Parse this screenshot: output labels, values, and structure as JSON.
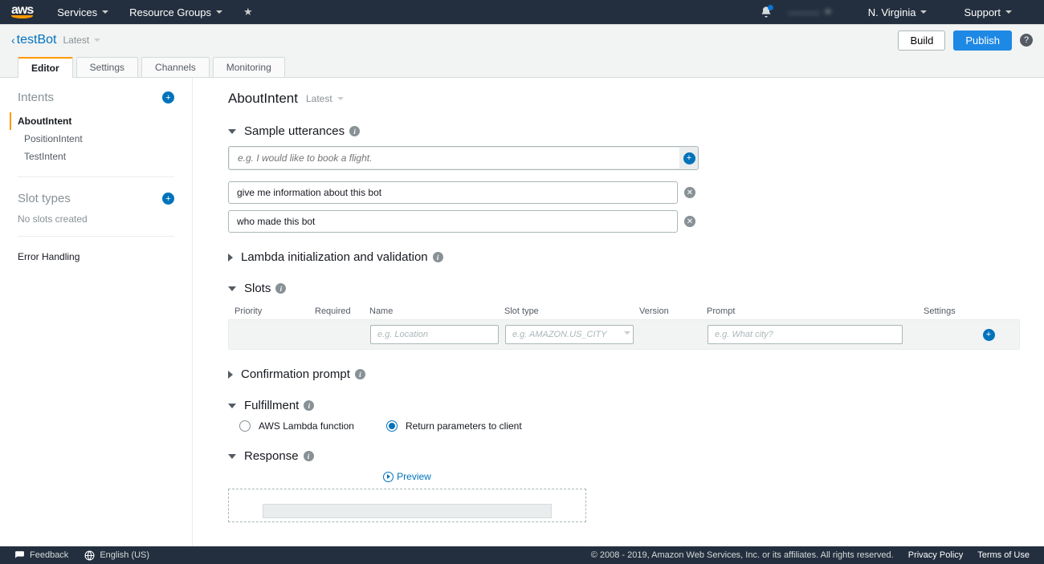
{
  "topbar": {
    "services": "Services",
    "resource_groups": "Resource Groups",
    "account_blur": "———",
    "region": "N. Virginia",
    "support": "Support"
  },
  "actionbar": {
    "bot_name": "testBot",
    "version_label": "Latest",
    "build": "Build",
    "publish": "Publish"
  },
  "tabs": [
    "Editor",
    "Settings",
    "Channels",
    "Monitoring"
  ],
  "sidebar": {
    "intents_label": "Intents",
    "intents": [
      "AboutIntent",
      "PositionIntent",
      "TestIntent"
    ],
    "slot_types_label": "Slot types",
    "slot_types_empty": "No slots created",
    "error_handling": "Error Handling"
  },
  "content": {
    "intent_name": "AboutIntent",
    "intent_version": "Latest",
    "sections": {
      "utterances": "Sample utterances",
      "lambda_init": "Lambda initialization and validation",
      "slots": "Slots",
      "confirmation": "Confirmation prompt",
      "fulfillment": "Fulfillment",
      "response": "Response"
    },
    "utterance_placeholder": "e.g. I would like to book a flight.",
    "utterances": [
      "give me information about this bot",
      "who made this bot"
    ],
    "slot_headers": {
      "priority": "Priority",
      "required": "Required",
      "name": "Name",
      "slot_type": "Slot type",
      "version": "Version",
      "prompt": "Prompt",
      "settings": "Settings"
    },
    "slot_placeholders": {
      "name": "e.g. Location",
      "type": "e.g. AMAZON.US_CITY",
      "prompt": "e.g. What city?"
    },
    "fulfillment_options": {
      "lambda": "AWS Lambda function",
      "return_params": "Return parameters to client"
    },
    "preview": "Preview"
  },
  "footer": {
    "feedback": "Feedback",
    "language": "English (US)",
    "copyright": "© 2008 - 2019, Amazon Web Services, Inc. or its affiliates. All rights reserved.",
    "privacy": "Privacy Policy",
    "terms": "Terms of Use"
  }
}
